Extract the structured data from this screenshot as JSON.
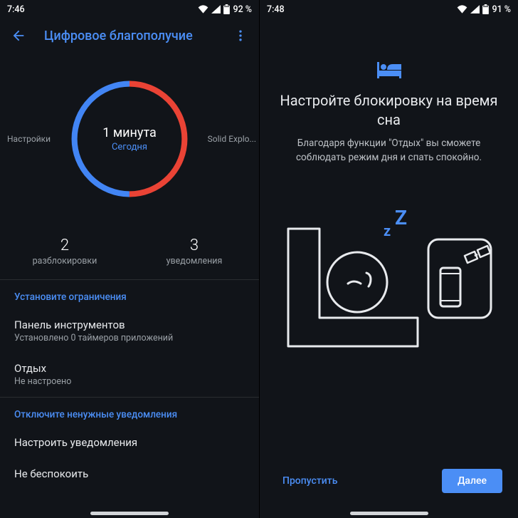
{
  "left": {
    "status": {
      "time": "7:46",
      "battery": "92 %"
    },
    "appbar": {
      "title": "Цифровое благополучие"
    },
    "donut": {
      "leftLabel": "Настройки",
      "rightLabel": "Solid Explo...",
      "centerBig": "1 минута",
      "centerSub": "Сегодня"
    },
    "stats": {
      "unlocks": {
        "num": "2",
        "label": "разблокировки"
      },
      "notifs": {
        "num": "3",
        "label": "уведомления"
      }
    },
    "sections": {
      "limitsTitle": "Установите ограничения",
      "dashboard": {
        "primary": "Панель инструментов",
        "secondary": "Установлено 0 таймеров приложений"
      },
      "winddown": {
        "primary": "Отдых",
        "secondary": "Не настроено"
      },
      "notifsTitle": "Отключите ненужные уведомления",
      "confNotifs": {
        "primary": "Настроить уведомления"
      },
      "dnd": {
        "primary": "Не беспокоить"
      }
    }
  },
  "right": {
    "status": {
      "time": "7:48",
      "battery": "91 %"
    },
    "onboard": {
      "heading": "Настройте блокировку на время сна",
      "body": "Благодаря функции \"Отдых\" вы сможете соблюдать режим дня и спать спокойно."
    },
    "footer": {
      "skip": "Пропустить",
      "next": "Далее"
    }
  },
  "colors": {
    "accent": "#4b8ef5",
    "red": "#ea4335",
    "blue": "#4285f4"
  },
  "chart_data": {
    "type": "pie",
    "title": "1 минута — Сегодня",
    "series": [
      {
        "name": "Настройки",
        "value": 50,
        "color": "#ea4335"
      },
      {
        "name": "Solid Explorer",
        "value": 50,
        "color": "#4285f4"
      }
    ]
  }
}
